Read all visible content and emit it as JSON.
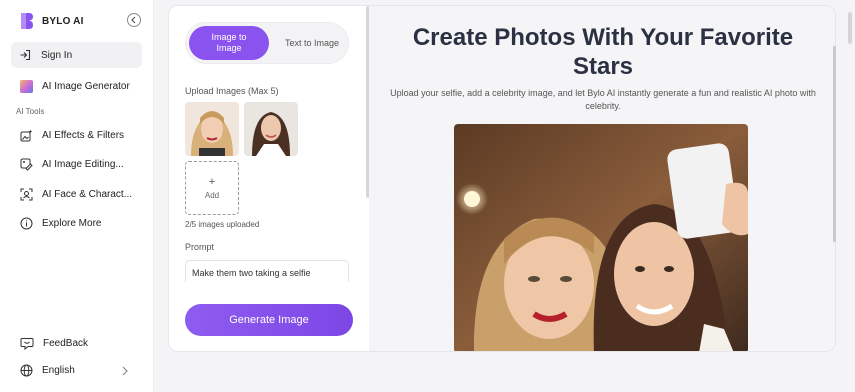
{
  "brand": {
    "name": "BYLO AI"
  },
  "sidebar": {
    "signin_label": "Sign In",
    "ai_image_generator": "AI Image Generator",
    "section_label": "AI Tools",
    "items": [
      {
        "label": "AI Effects & Filters",
        "icon": "sparkle-image-icon"
      },
      {
        "label": "AI Image Editing...",
        "icon": "image-edit-icon"
      },
      {
        "label": "AI Face & Charact...",
        "icon": "face-scan-icon"
      },
      {
        "label": "Explore More",
        "icon": "info-circle-icon"
      }
    ],
    "feedback_label": "FeedBack",
    "language_label": "English"
  },
  "tool": {
    "tab_active": "Image to Image",
    "tab_inactive": "Text to Image",
    "upload_label": "Upload Images (Max 5)",
    "add_label": "Add",
    "uploaded_status": "2/5 images uploaded",
    "prompt_label": "Prompt",
    "prompt_value": "Make them two taking a selfie",
    "generate_label": "Generate Image"
  },
  "hero": {
    "title": "Create Photos With Your Favorite Stars",
    "subtitle": "Upload your selfie, add a celebrity image, and let Bylo AI instantly generate a fun and realistic AI photo with celebrity."
  },
  "colors": {
    "accent": "#8a52ee",
    "title": "#2b3142"
  }
}
